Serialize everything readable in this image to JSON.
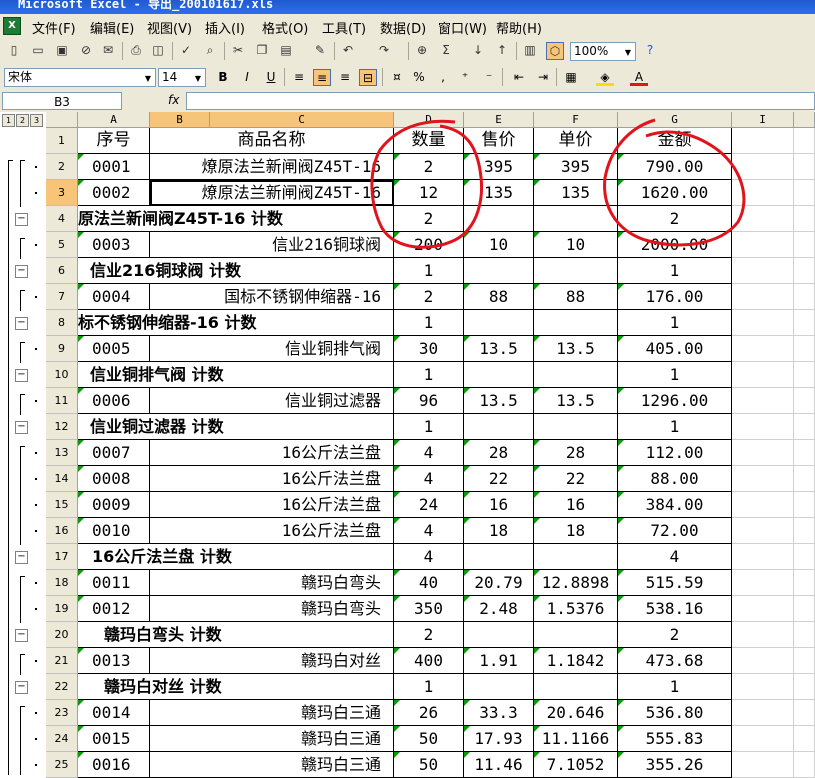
{
  "window": {
    "title": "Microsoft Excel - 导出_200101617.xls"
  },
  "menu": [
    "文件(F)",
    "编辑(E)",
    "视图(V)",
    "插入(I)",
    "格式(O)",
    "工具(T)",
    "数据(D)",
    "窗口(W)",
    "帮助(H)"
  ],
  "toolbar": {
    "zoom": "100%",
    "font_name": "宋体",
    "font_size": "14"
  },
  "formula_bar": {
    "name_box": "B3",
    "fx": "fx",
    "content": ""
  },
  "outline_levels": [
    "1",
    "2",
    "3"
  ],
  "columns": [
    {
      "id": "A",
      "label": "A"
    },
    {
      "id": "B",
      "label": "B"
    },
    {
      "id": "C",
      "label": "C"
    },
    {
      "id": "D",
      "label": "D"
    },
    {
      "id": "E",
      "label": "E"
    },
    {
      "id": "F",
      "label": "F"
    },
    {
      "id": "G",
      "label": "G"
    },
    {
      "id": "I",
      "label": "I"
    }
  ],
  "rows": [
    {
      "num": "1",
      "type": "header",
      "a": "序号",
      "bc": "商品名称",
      "d": "数量",
      "e": "售价",
      "f": "单价",
      "g": "金额"
    },
    {
      "num": "2",
      "type": "item",
      "a": "0001",
      "bc": "燎原法兰新闸阀Z45T-16",
      "d": "2",
      "e": "395",
      "f": "395",
      "g": "790.00"
    },
    {
      "num": "3",
      "type": "item",
      "a": "0002",
      "bc": "燎原法兰新闸阀Z45T-16",
      "d": "12",
      "e": "135",
      "f": "135",
      "g": "1620.00"
    },
    {
      "num": "4",
      "type": "subtotal",
      "label": "原法兰新闸阀Z45T-16 计数",
      "d": "2",
      "g": "2"
    },
    {
      "num": "5",
      "type": "item",
      "a": "0003",
      "bc": "信业216铜球阀",
      "d": "200",
      "e": "10",
      "f": "10",
      "g": "2000.00"
    },
    {
      "num": "6",
      "type": "subtotal",
      "label": "信业216铜球阀 计数",
      "d": "1",
      "g": "1"
    },
    {
      "num": "7",
      "type": "item",
      "a": "0004",
      "bc": "国标不锈钢伸缩器-16",
      "d": "2",
      "e": "88",
      "f": "88",
      "g": "176.00"
    },
    {
      "num": "8",
      "type": "subtotal",
      "label": "标不锈钢伸缩器-16 计数",
      "d": "1",
      "g": "1"
    },
    {
      "num": "9",
      "type": "item",
      "a": "0005",
      "bc": "信业铜排气阀",
      "d": "30",
      "e": "13.5",
      "f": "13.5",
      "g": "405.00"
    },
    {
      "num": "10",
      "type": "subtotal",
      "label": "信业铜排气阀 计数",
      "d": "1",
      "g": "1"
    },
    {
      "num": "11",
      "type": "item",
      "a": "0006",
      "bc": "信业铜过滤器",
      "d": "96",
      "e": "13.5",
      "f": "13.5",
      "g": "1296.00"
    },
    {
      "num": "12",
      "type": "subtotal",
      "label": "信业铜过滤器 计数",
      "d": "1",
      "g": "1"
    },
    {
      "num": "13",
      "type": "item",
      "a": "0007",
      "bc": "16公斤法兰盘",
      "d": "4",
      "e": "28",
      "f": "28",
      "g": "112.00"
    },
    {
      "num": "14",
      "type": "item",
      "a": "0008",
      "bc": "16公斤法兰盘",
      "d": "4",
      "e": "22",
      "f": "22",
      "g": "88.00"
    },
    {
      "num": "15",
      "type": "item",
      "a": "0009",
      "bc": "16公斤法兰盘",
      "d": "24",
      "e": "16",
      "f": "16",
      "g": "384.00"
    },
    {
      "num": "16",
      "type": "item",
      "a": "0010",
      "bc": "16公斤法兰盘",
      "d": "4",
      "e": "18",
      "f": "18",
      "g": "72.00"
    },
    {
      "num": "17",
      "type": "subtotal",
      "label": "16公斤法兰盘 计数",
      "d": "4",
      "g": "4"
    },
    {
      "num": "18",
      "type": "item",
      "a": "0011",
      "bc": "赣玛白弯头",
      "d": "40",
      "e": "20.79",
      "f": "12.8898",
      "g": "515.59"
    },
    {
      "num": "19",
      "type": "item",
      "a": "0012",
      "bc": "赣玛白弯头",
      "d": "350",
      "e": "2.48",
      "f": "1.5376",
      "g": "538.16"
    },
    {
      "num": "20",
      "type": "subtotal",
      "label": "赣玛白弯头 计数",
      "d": "2",
      "g": "2"
    },
    {
      "num": "21",
      "type": "item",
      "a": "0013",
      "bc": "赣玛白对丝",
      "d": "400",
      "e": "1.91",
      "f": "1.1842",
      "g": "473.68"
    },
    {
      "num": "22",
      "type": "subtotal",
      "label": "赣玛白对丝 计数",
      "d": "1",
      "g": "1"
    },
    {
      "num": "23",
      "type": "item",
      "a": "0014",
      "bc": "赣玛白三通",
      "d": "26",
      "e": "33.3",
      "f": "20.646",
      "g": "536.80"
    },
    {
      "num": "24",
      "type": "item",
      "a": "0015",
      "bc": "赣玛白三通",
      "d": "50",
      "e": "17.93",
      "f": "11.1166",
      "g": "555.83"
    },
    {
      "num": "25",
      "type": "item",
      "a": "0016",
      "bc": "赣玛白三通",
      "d": "50",
      "e": "11.46",
      "f": "7.1052",
      "g": "355.26"
    }
  ],
  "colors": {
    "chrome": "#ece9d8",
    "selected_header": "#f7c57a",
    "annotation": "#e0141c",
    "titlebar": "#2e6fe8"
  }
}
